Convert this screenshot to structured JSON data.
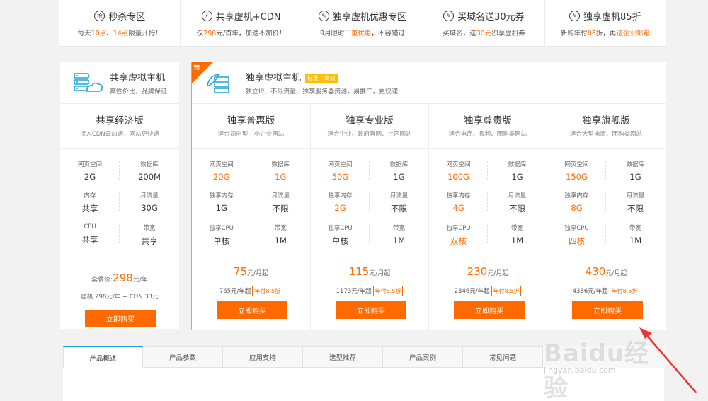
{
  "promos": [
    {
      "icon": "抢",
      "title": "秒杀专区",
      "sub": [
        [
          "每天",
          ""
        ],
        [
          "10点",
          "hl"
        ],
        [
          "、",
          ""
        ],
        [
          "14点",
          "hl"
        ],
        [
          "限量开抢！",
          ""
        ]
      ]
    },
    {
      "icon": "⚡",
      "title": "共享虚机+CDN",
      "sub": [
        [
          "仅",
          ""
        ],
        [
          "298",
          "hl"
        ],
        [
          "元/首年，加速不加价！",
          ""
        ]
      ]
    },
    {
      "icon": "✎",
      "title": "独享虚机优惠专区",
      "sub": [
        [
          "9月限时",
          ""
        ],
        [
          "三重优惠",
          "hl"
        ],
        [
          "，不容错过",
          ""
        ]
      ]
    },
    {
      "icon": "✎",
      "title": "买域名送30元券",
      "sub": [
        [
          "买域名，送",
          ""
        ],
        [
          "30元",
          "hl"
        ],
        [
          "独享虚机券",
          ""
        ]
      ]
    },
    {
      "icon": "✎",
      "title": "独享虚机85折",
      "sub": [
        [
          "新购年付",
          ""
        ],
        [
          "85",
          "hl"
        ],
        [
          "折，再",
          ""
        ],
        [
          "送企业邮箱",
          "hl"
        ]
      ]
    }
  ],
  "shared": {
    "title": "共享虚拟主机",
    "subtitle": "高性价比，品牌保证",
    "plan": {
      "name": "共享经济版",
      "desc": "接入CDN云加速，网站更快速",
      "specs": [
        {
          "label": "网页空间",
          "value": "2G"
        },
        {
          "label": "数据库",
          "value": "200M"
        },
        {
          "label": "内存",
          "value": "共享"
        },
        {
          "label": "月流量",
          "value": "30G"
        },
        {
          "label": "CPU",
          "value": "共享"
        },
        {
          "label": "带宽",
          "value": "共享"
        }
      ],
      "price_prefix": "套餐价:",
      "price": "298",
      "price_unit": "元/年",
      "sub_line": "虚机 298元/年 + CDN 33元",
      "button": "立即购买"
    }
  },
  "exclusive": {
    "ribbon": "荐",
    "title": "独享虚拟主机",
    "tag": "标准 | 高效",
    "subtitle": "独立IP、不限流量、独享服务器资源，易推广，更快速",
    "plans": [
      {
        "name": "独享普惠版",
        "desc": "适合初创型中小企业网站",
        "specs": [
          {
            "label": "网页空间",
            "value": "20G",
            "hl": true
          },
          {
            "label": "数据库",
            "value": "1G",
            "hl": true
          },
          {
            "label": "独享内存",
            "value": "1G",
            "hl": false
          },
          {
            "label": "月流量",
            "value": "不限",
            "hl": false
          },
          {
            "label": "独享CPU",
            "value": "单核",
            "hl": false
          },
          {
            "label": "带宽",
            "value": "1M",
            "hl": false
          }
        ],
        "price": "75",
        "price_unit": "元/月起",
        "year_price": "765元/年起",
        "discount": "年付8.5折",
        "button": "立即购买"
      },
      {
        "name": "独享专业版",
        "desc": "适合企业、政府官网、社区网站",
        "specs": [
          {
            "label": "网页空间",
            "value": "50G",
            "hl": true
          },
          {
            "label": "数据库",
            "value": "1G",
            "hl": false
          },
          {
            "label": "独享内存",
            "value": "2G",
            "hl": true
          },
          {
            "label": "月流量",
            "value": "不限",
            "hl": false
          },
          {
            "label": "独享CPU",
            "value": "单核",
            "hl": false
          },
          {
            "label": "带宽",
            "value": "1M",
            "hl": false
          }
        ],
        "price": "115",
        "price_unit": "元/月起",
        "year_price": "1173元/年起",
        "discount": "年付8.5折",
        "button": "立即购买"
      },
      {
        "name": "独享尊贵版",
        "desc": "适合电商、视频、团购类网站",
        "specs": [
          {
            "label": "网页空间",
            "value": "100G",
            "hl": true
          },
          {
            "label": "数据库",
            "value": "1G",
            "hl": false
          },
          {
            "label": "独享内存",
            "value": "4G",
            "hl": true
          },
          {
            "label": "月流量",
            "value": "不限",
            "hl": false
          },
          {
            "label": "独享CPU",
            "value": "双核",
            "hl": true
          },
          {
            "label": "带宽",
            "value": "1M",
            "hl": false
          }
        ],
        "price": "230",
        "price_unit": "元/月起",
        "year_price": "2346元/年起",
        "discount": "年付8.5折",
        "button": "立即购买"
      },
      {
        "name": "独享旗舰版",
        "desc": "适合大型电商、团购类网站",
        "specs": [
          {
            "label": "网页空间",
            "value": "150G",
            "hl": true
          },
          {
            "label": "数据库",
            "value": "1G",
            "hl": false
          },
          {
            "label": "独享内存",
            "value": "8G",
            "hl": true
          },
          {
            "label": "月流量",
            "value": "不限",
            "hl": false
          },
          {
            "label": "独享CPU",
            "value": "四核",
            "hl": true
          },
          {
            "label": "带宽",
            "value": "1M",
            "hl": false
          }
        ],
        "price": "430",
        "price_unit": "元/月起",
        "year_price": "4386元/年起",
        "discount": "年付8.5折",
        "button": "立即购买"
      }
    ]
  },
  "tabs": [
    "产品概述",
    "产品参数",
    "应用支持",
    "选型推荐",
    "产品案例",
    "常见问题"
  ],
  "active_tab": 0,
  "watermark": {
    "text": "Baidu经验",
    "url": "jingyan.baidu.com"
  },
  "colors": {
    "accent": "#ff6a00",
    "tab_active": "#1a9ed9"
  }
}
